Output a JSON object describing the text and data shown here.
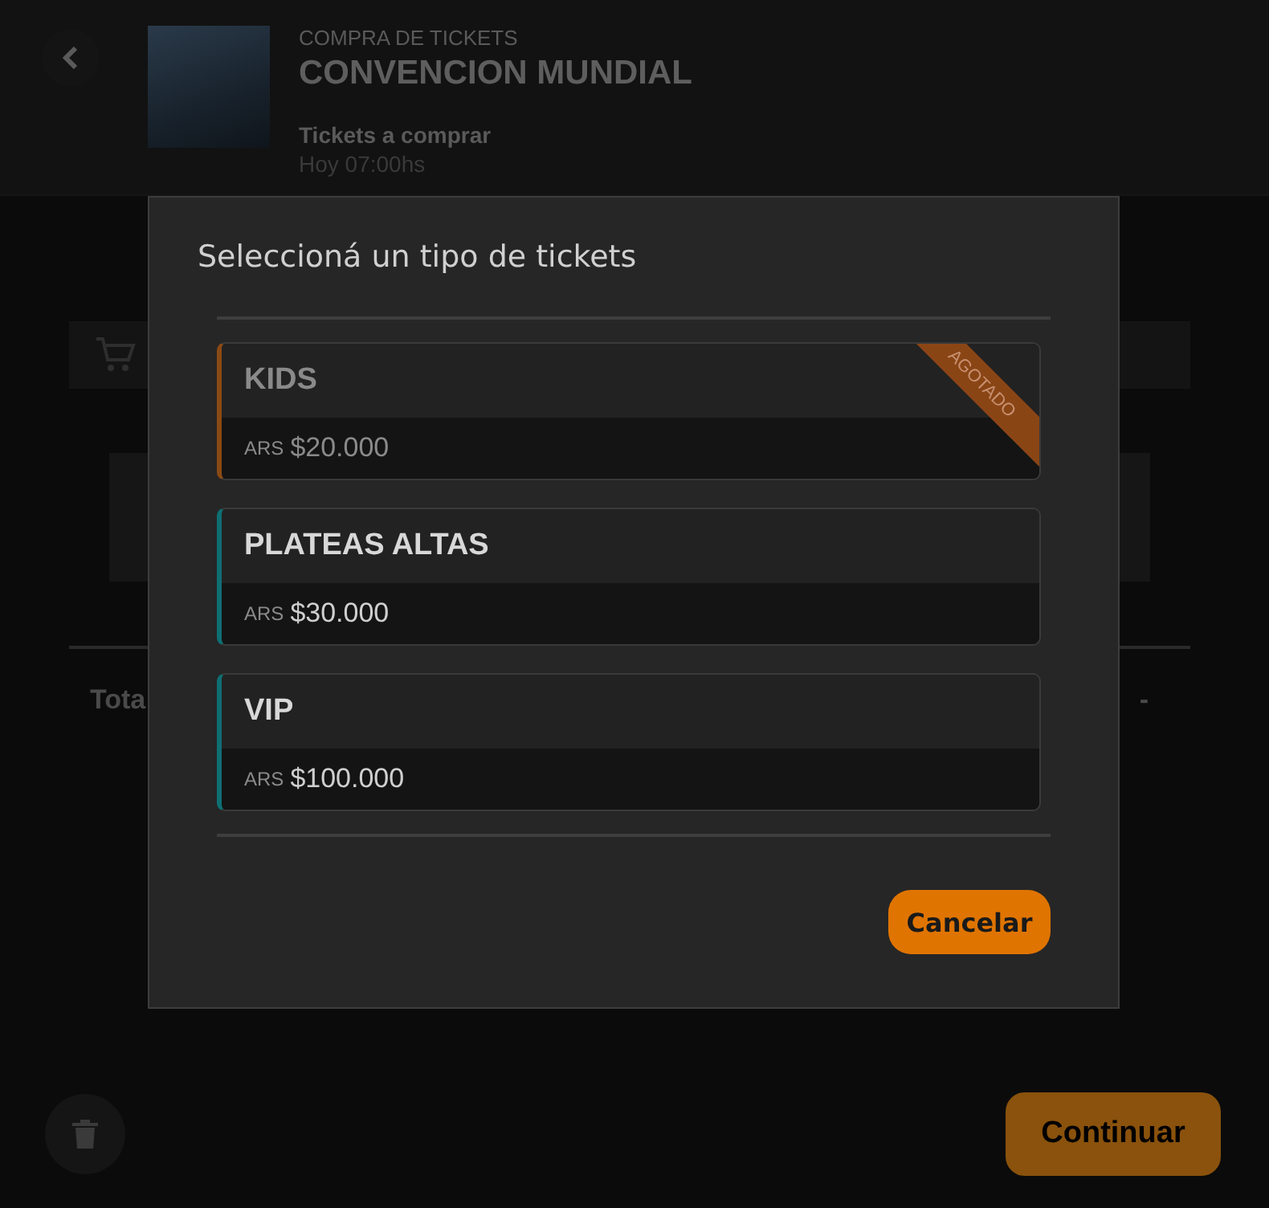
{
  "header": {
    "kicker": "COMPRA DE TICKETS",
    "title": "CONVENCION MUNDIAL",
    "subtitle": "Tickets a comprar",
    "time": "Hoy 07:00hs"
  },
  "summary": {
    "total_label": "Tota",
    "total_value": "-"
  },
  "footer": {
    "continue_label": "Continuar"
  },
  "dialog": {
    "title": "Seleccioná un tipo de tickets",
    "tickets": [
      {
        "name": "KIDS",
        "currency": "ARS",
        "price": "$20.000",
        "sold_out": true,
        "badge": "AGOTADO"
      },
      {
        "name": "PLATEAS ALTAS",
        "currency": "ARS",
        "price": "$30.000",
        "sold_out": false
      },
      {
        "name": "VIP",
        "currency": "ARS",
        "price": "$100.000",
        "sold_out": false
      }
    ],
    "cancel_label": "Cancelar"
  }
}
